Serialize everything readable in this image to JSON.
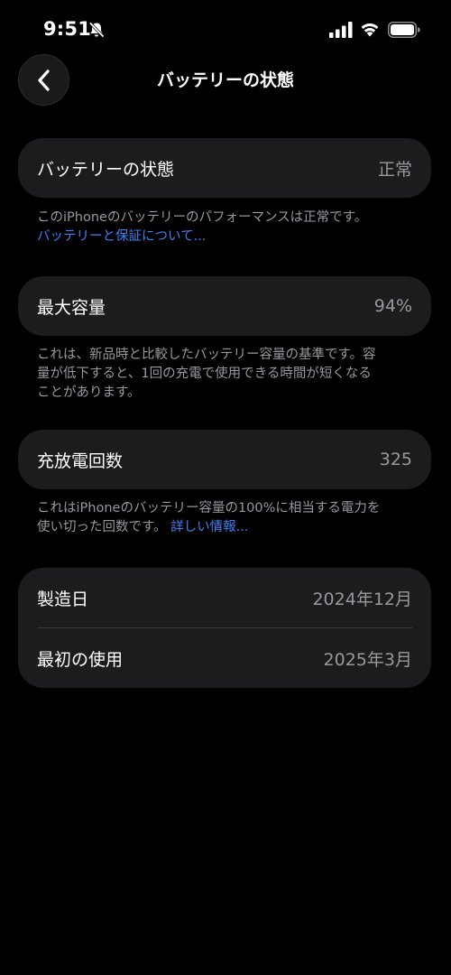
{
  "status_bar": {
    "time": "9:51"
  },
  "nav": {
    "title": "バッテリーの状態"
  },
  "battery_health": {
    "label": "バッテリーの状態",
    "value": "正常",
    "note": "このiPhoneのバッテリーのパフォーマンスは正常です。",
    "link": "バッテリーと保証について..."
  },
  "max_capacity": {
    "label": "最大容量",
    "value": "94%",
    "note_line1": "これは、新品時と比較したバッテリー容量の基準です。容",
    "note_line2": "量が低下すると、1回の充電で使用できる時間が短くなる",
    "note_line3": "ことがあります。"
  },
  "cycle_count": {
    "label": "充放電回数",
    "value": "325",
    "note_line1": "これはiPhoneのバッテリー容量の100%に相当する電力を",
    "note_line2": "使い切った回数です。",
    "link": "詳しい情報..."
  },
  "dates": {
    "manufactured_label": "製造日",
    "manufactured_value": "2024年12月",
    "first_use_label": "最初の使用",
    "first_use_value": "2025年3月"
  },
  "colors": {
    "background": "#000000",
    "card": "#1c1c1e",
    "secondary_text": "#98989f",
    "link": "#3b82f6"
  }
}
